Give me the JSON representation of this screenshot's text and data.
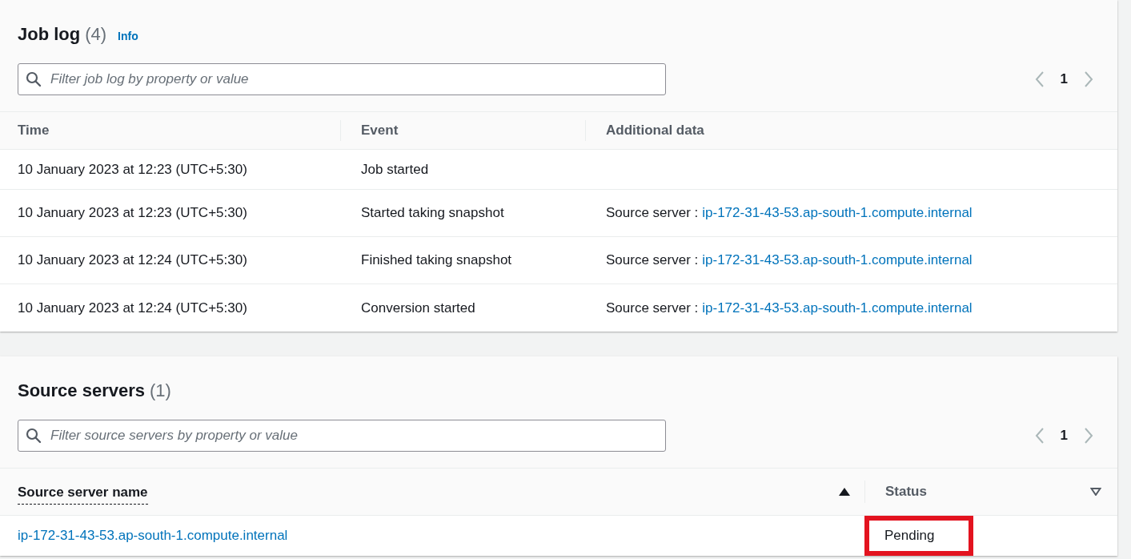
{
  "job_log": {
    "title": "Job log",
    "count": "(4)",
    "info": "Info",
    "search": {
      "placeholder": "Filter job log by property or value"
    },
    "pagination": {
      "page": "1"
    },
    "columns": [
      "Time",
      "Event",
      "Additional data"
    ],
    "rows": [
      {
        "time": "10 January 2023 at 12:23 (UTC+5:30)",
        "event": "Job started"
      },
      {
        "time": "10 January 2023 at 12:23 (UTC+5:30)",
        "event": "Started taking snapshot",
        "additional_label": "Source server :",
        "additional_link": "ip-172-31-43-53.ap-south-1.compute.internal"
      },
      {
        "time": "10 January 2023 at 12:24 (UTC+5:30)",
        "event": "Finished taking snapshot",
        "additional_label": "Source server :",
        "additional_link": "ip-172-31-43-53.ap-south-1.compute.internal"
      },
      {
        "time": "10 January 2023 at 12:24 (UTC+5:30)",
        "event": "Conversion started",
        "additional_label": "Source server :",
        "additional_link": "ip-172-31-43-53.ap-south-1.compute.internal"
      }
    ]
  },
  "source_servers": {
    "title": "Source servers",
    "count": "(1)",
    "search": {
      "placeholder": "Filter source servers by property or value"
    },
    "pagination": {
      "page": "1"
    },
    "columns": [
      {
        "label": "Source server name",
        "sorted": true
      },
      {
        "label": "Status",
        "sorted": false
      }
    ],
    "rows": [
      {
        "name": "ip-172-31-43-53.ap-south-1.compute.internal",
        "status": "Pending",
        "highlighted": true
      }
    ]
  }
}
